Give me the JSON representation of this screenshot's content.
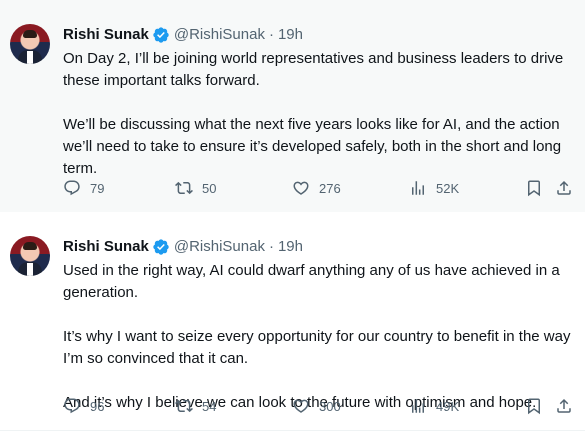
{
  "tweets": [
    {
      "author_name": "Rishi Sunak",
      "handle": "@RishiSunak",
      "separator": "·",
      "time": "19h",
      "paragraphs": [
        "On Day 2, I’ll be joining world representatives and business leaders to drive these important talks forward.",
        "We’ll be discussing what the next five years looks like for AI, and the action we’ll need to take to ensure it’s developed safely, both in the short and long term."
      ],
      "replies": "79",
      "reposts": "50",
      "likes": "276",
      "views": "52K"
    },
    {
      "author_name": "Rishi Sunak",
      "handle": "@RishiSunak",
      "separator": "·",
      "time": "19h",
      "paragraphs": [
        "Used in the right way, AI could dwarf anything any of us have achieved in a generation.",
        "It’s why I want to seize every opportunity for our country to benefit in the way I’m so convinced that it can.",
        "And it’s why I believe we can look to the future with optimism and hope."
      ],
      "replies": "96",
      "reposts": "54",
      "likes": "300",
      "views": "49K"
    }
  ],
  "icons": {
    "verified": "verified-badge-icon",
    "reply": "reply-icon",
    "repost": "repost-icon",
    "like": "heart-icon",
    "views": "views-chart-icon",
    "bookmark": "bookmark-icon",
    "share": "share-icon"
  },
  "colors": {
    "verified_badge": "#1d9bf0",
    "secondary_text": "#536471",
    "primary_text": "#0f1419",
    "hover_background": "#f7f9f9"
  }
}
